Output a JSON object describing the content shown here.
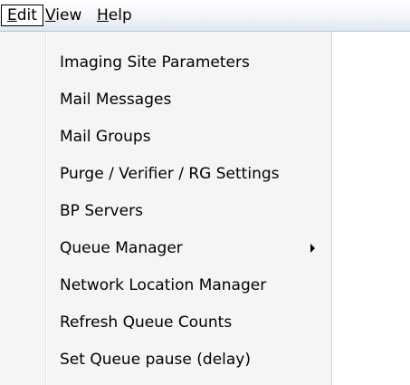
{
  "menubar": {
    "items": [
      {
        "mnemonic": "E",
        "rest": "dit",
        "active": true
      },
      {
        "mnemonic": "V",
        "rest": "iew",
        "active": false
      },
      {
        "mnemonic": "H",
        "rest": "elp",
        "active": false
      }
    ]
  },
  "edit_menu": {
    "items": [
      {
        "label": "Imaging Site Parameters",
        "has_submenu": false
      },
      {
        "label": "Mail Messages",
        "has_submenu": false
      },
      {
        "label": "Mail Groups",
        "has_submenu": false
      },
      {
        "label": "Purge / Verifier / RG Settings",
        "has_submenu": false
      },
      {
        "label": "BP Servers",
        "has_submenu": false
      },
      {
        "label": "Queue Manager",
        "has_submenu": true
      },
      {
        "label": "Network Location Manager",
        "has_submenu": false
      },
      {
        "label": "Refresh Queue Counts",
        "has_submenu": false
      },
      {
        "label": "Set Queue pause (delay)",
        "has_submenu": false
      }
    ],
    "submenu_arrow_icon": "triangle-right-icon"
  }
}
